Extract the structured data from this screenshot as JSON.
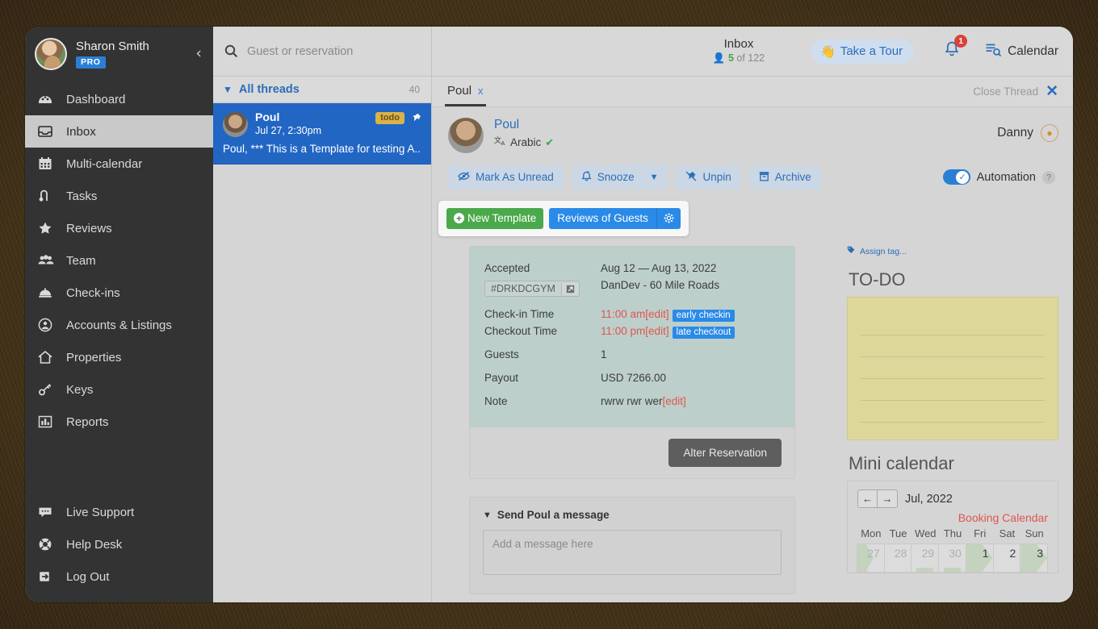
{
  "sidebar": {
    "user": {
      "name": "Sharon Smith",
      "plan": "PRO"
    },
    "collapse_icon": "chevron-left-icon",
    "items": [
      {
        "label": "Dashboard",
        "icon": "dashboard-icon",
        "active": false
      },
      {
        "label": "Inbox",
        "icon": "inbox-icon",
        "active": true
      },
      {
        "label": "Multi-calendar",
        "icon": "calendar-icon",
        "active": false
      },
      {
        "label": "Tasks",
        "icon": "tasks-icon",
        "active": false
      },
      {
        "label": "Reviews",
        "icon": "star-icon",
        "active": false
      },
      {
        "label": "Team",
        "icon": "team-icon",
        "active": false
      },
      {
        "label": "Check-ins",
        "icon": "bell-desk-icon",
        "active": false
      },
      {
        "label": "Accounts & Listings",
        "icon": "user-circle-icon",
        "active": false
      },
      {
        "label": "Properties",
        "icon": "home-icon",
        "active": false
      },
      {
        "label": "Keys",
        "icon": "key-icon",
        "active": false
      },
      {
        "label": "Reports",
        "icon": "bar-chart-icon",
        "active": false
      }
    ],
    "bottom_items": [
      {
        "label": "Live Support",
        "icon": "chat-bubble-icon"
      },
      {
        "label": "Help Desk",
        "icon": "lifebuoy-icon"
      },
      {
        "label": "Log Out",
        "icon": "logout-icon"
      }
    ]
  },
  "threadlist": {
    "search_placeholder": "Guest or reservation",
    "search_value": "",
    "search_icon": "search-icon",
    "all_threads_label": "All threads",
    "all_threads_count": "40",
    "threads": [
      {
        "name": "Poul",
        "date": "Jul 27, 2:30pm",
        "badge": "todo",
        "pinned": true,
        "snippet": "Poul, *** This is a Template for testing A..."
      }
    ]
  },
  "topbar": {
    "title": "Inbox",
    "subtitle_count": "5",
    "subtitle_rest": " of 122",
    "tour_label": "Take a Tour",
    "tour_icon": "waving-hand-icon",
    "bell_icon": "bell-icon",
    "bell_count": "1",
    "calendar_label": "Calendar",
    "calendar_icon": "calendar-search-icon"
  },
  "tabbar": {
    "tab_label": "Poul",
    "tab_close": "x",
    "close_thread_label": "Close Thread",
    "close_thread_icon": "close-icon"
  },
  "conversation": {
    "guest_name": "Poul",
    "language": "Arabic",
    "language_icon": "translate-icon",
    "verified_icon": "verified-check-icon",
    "assignee": "Danny",
    "assignee_icon": "airbnb-icon",
    "actions": [
      {
        "label": "Mark As Unread",
        "icon": "eye-slash-icon",
        "caret": false
      },
      {
        "label": "Snooze",
        "icon": "bell-snooze-icon",
        "caret": true
      },
      {
        "label": "Unpin",
        "icon": "unpin-icon",
        "caret": false
      },
      {
        "label": "Archive",
        "icon": "archive-icon",
        "caret": false
      }
    ],
    "automation_label": "Automation",
    "automation_help": "?",
    "automation_on": true
  },
  "template_popup": {
    "new_template_label": "New Template",
    "new_template_icon": "plus-circle-icon",
    "reviews_label": "Reviews of Guests",
    "gear_icon": "gear-icon"
  },
  "reservation": {
    "status_label": "Accepted",
    "code": "#DRKDCGYM",
    "code_link_icon": "external-link-icon",
    "dates": "Aug 12 — Aug 13, 2022",
    "listing": "DanDev - 60 Mile Roads",
    "rows": [
      {
        "label": "Check-in Time",
        "value": "11:00 am",
        "edit": "[edit]",
        "chip": "early checkin"
      },
      {
        "label": "Checkout Time",
        "value": "11:00 pm",
        "edit": "[edit]",
        "chip": "late checkout"
      },
      {
        "label": "Guests",
        "value": "1",
        "edit": "",
        "chip": ""
      },
      {
        "label": "Payout",
        "value": "USD 7266.00",
        "edit": "",
        "chip": ""
      },
      {
        "label": "Note",
        "value": "rwrw rwr wer",
        "edit": "[edit]",
        "chip": ""
      }
    ],
    "alter_button": "Alter Reservation"
  },
  "message_composer": {
    "title": "Send Poul a message",
    "collapse_icon": "chevron-down-icon",
    "placeholder": "Add a message here",
    "value": ""
  },
  "right_panel": {
    "assign_tag_label": "Assign tag...",
    "assign_tag_icon": "tag-icon",
    "todo_title": "TO-DO",
    "todo_lines": [
      "",
      "",
      "",
      "",
      ""
    ],
    "mini_calendar_title": "Mini calendar",
    "prev_icon": "arrow-left-icon",
    "next_icon": "arrow-right-icon",
    "month": "Jul, 2022",
    "booking_calendar_label": "Booking Calendar",
    "day_names": [
      "Mon",
      "Tue",
      "Wed",
      "Thu",
      "Fri",
      "Sat",
      "Sun"
    ],
    "dates": [
      {
        "num": "27",
        "muted": true,
        "style": "arrow"
      },
      {
        "num": "28",
        "muted": true,
        "style": "plain"
      },
      {
        "num": "29",
        "muted": true,
        "style": "bottom"
      },
      {
        "num": "30",
        "muted": true,
        "style": "bottom"
      },
      {
        "num": "1",
        "muted": false,
        "style": "arrow-r"
      },
      {
        "num": "2",
        "muted": false,
        "style": "plain"
      },
      {
        "num": "3",
        "muted": false,
        "style": "arrow-r"
      }
    ]
  },
  "colors": {
    "sidebar_bg": "#333333",
    "accent_blue": "#2a6ebb",
    "thread_selected": "#2266c4",
    "green": "#4aa94a",
    "red": "#e0564f",
    "reservation_bg": "#bdcfcb",
    "todo_bg": "#ddd89a"
  }
}
